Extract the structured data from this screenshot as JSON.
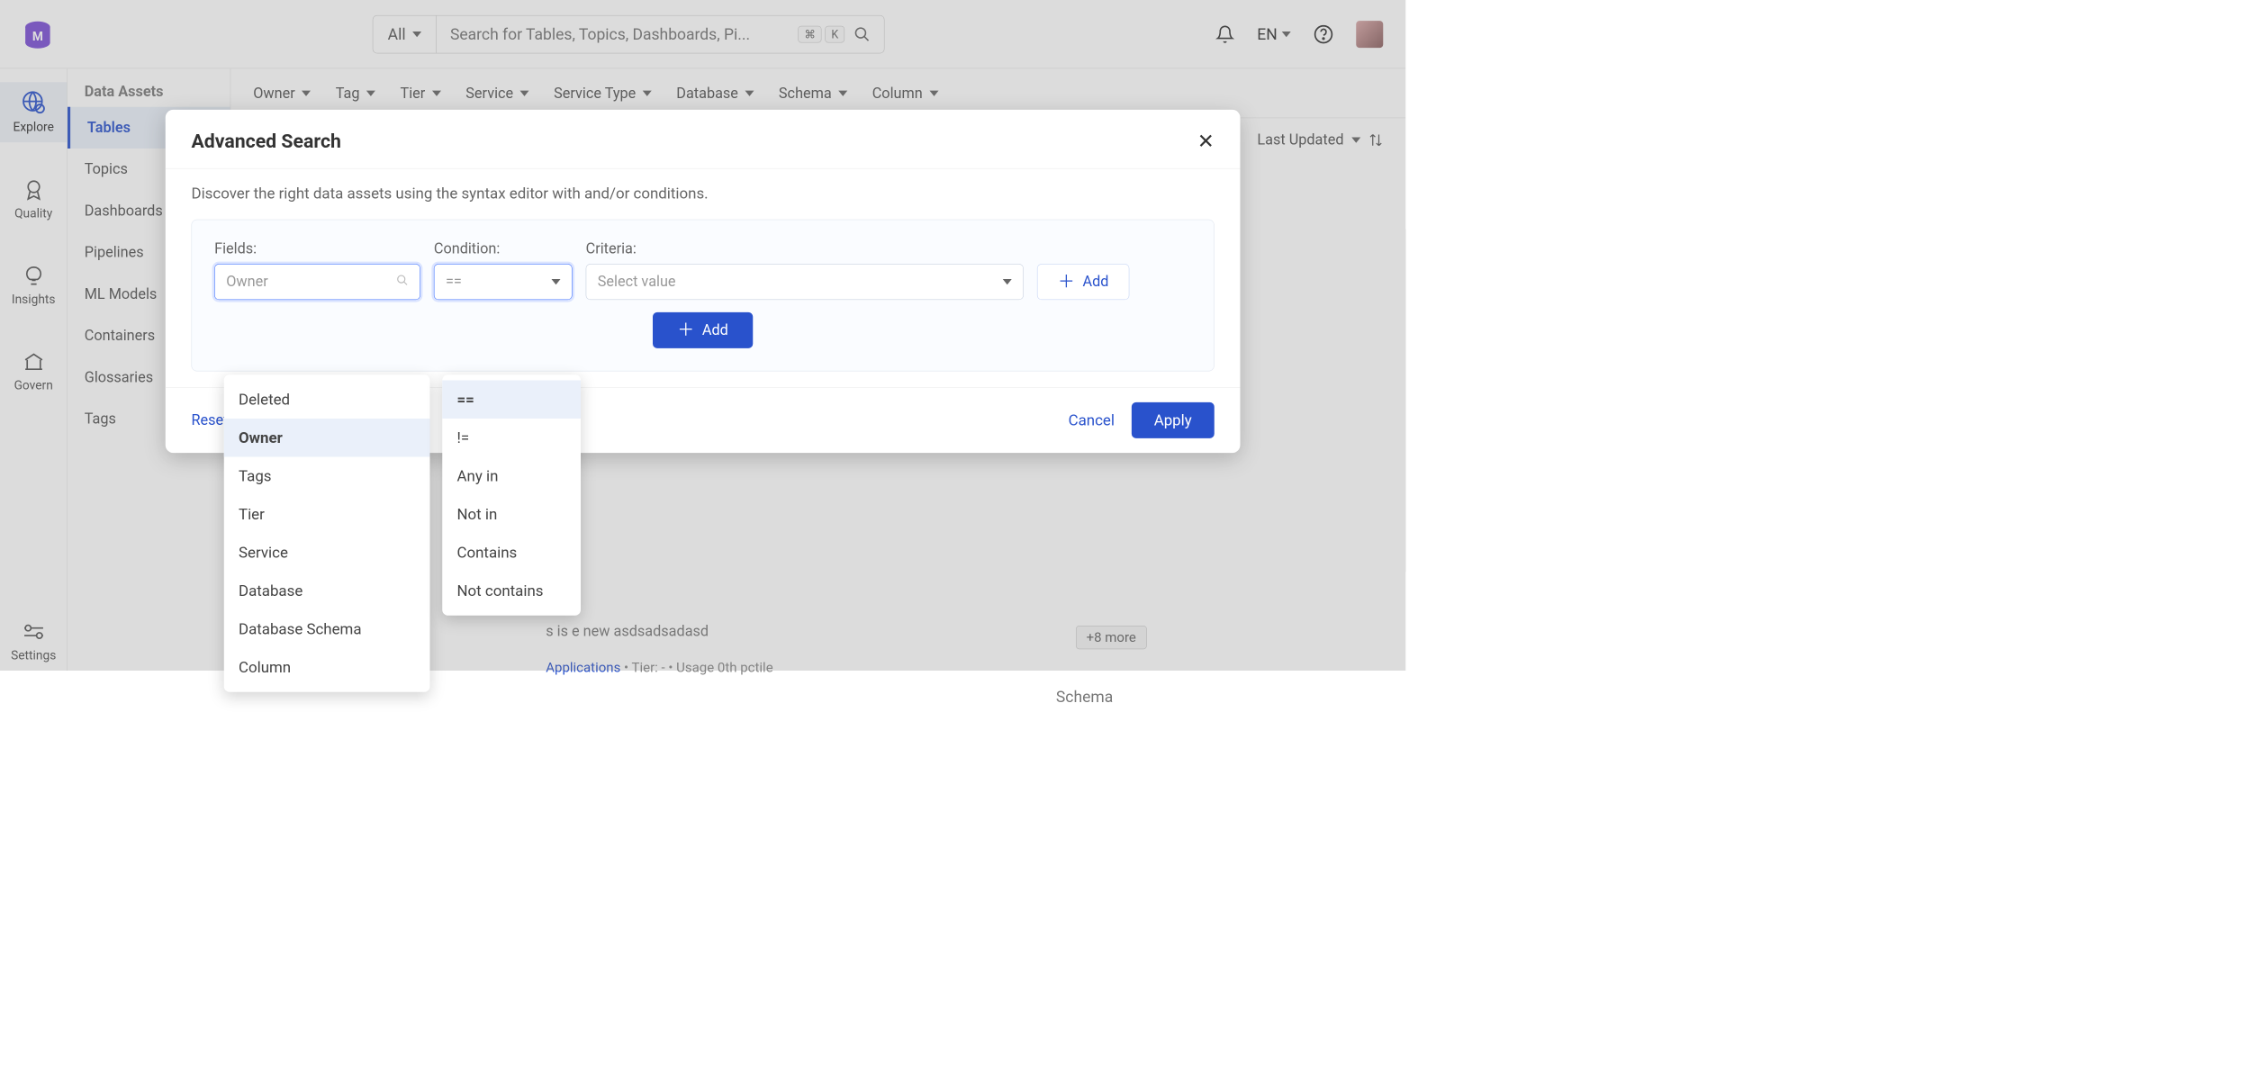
{
  "topbar": {
    "search_all": "All",
    "search_placeholder": "Search for Tables, Topics, Dashboards, Pi...",
    "kbd1": "⌘",
    "kbd2": "K",
    "lang": "EN"
  },
  "leftnav": {
    "explore": "Explore",
    "quality": "Quality",
    "insights": "Insights",
    "govern": "Govern",
    "settings": "Settings"
  },
  "sidecol": {
    "header": "Data Assets",
    "items": [
      "Tables",
      "Topics",
      "Dashboards",
      "Pipelines",
      "ML Models",
      "Containers",
      "Glossaries",
      "Tags"
    ],
    "active_index": 0
  },
  "filterbar": [
    "Owner",
    "Tag",
    "Tier",
    "Service",
    "Service Type",
    "Database",
    "Schema",
    "Column"
  ],
  "sort": {
    "label": "Last Updated"
  },
  "bg": {
    "desc_prefix": "s is ",
    "desc_mid": "e  new asdsadsadasd",
    "crumb_app": "Applications",
    "crumb_tier_label": " •  Tier: ",
    "crumb_tier_dash": "-",
    "crumb_usage": " •  Usage 0th pctile",
    "more": "+8 more",
    "schema": "Schema"
  },
  "modal": {
    "title": "Advanced Search",
    "hint": "Discover the right data assets using the syntax editor with and/or conditions.",
    "labels": {
      "fields": "Fields:",
      "condition": "Condition:",
      "criteria": "Criteria:"
    },
    "fields_placeholder": "Owner",
    "condition_placeholder": "==",
    "criteria_placeholder": "Select value",
    "add": "Add",
    "add_row": "Add",
    "reset": "Reset",
    "cancel": "Cancel",
    "apply": "Apply",
    "fields_options": [
      "Deleted",
      "Owner",
      "Tags",
      "Tier",
      "Service",
      "Database",
      "Database Schema",
      "Column"
    ],
    "fields_selected_index": 1,
    "condition_options": [
      "==",
      "!=",
      "Any in",
      "Not in",
      "Contains",
      "Not contains"
    ],
    "condition_selected_index": 0
  }
}
